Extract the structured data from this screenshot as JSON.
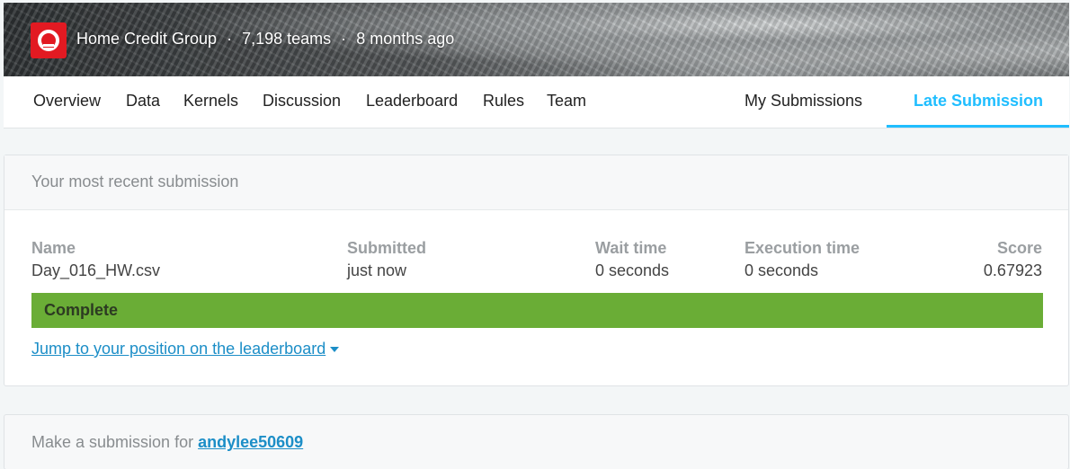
{
  "banner": {
    "host": "Home Credit Group",
    "teams": "7,198 teams",
    "age": "8 months ago",
    "separator": "·"
  },
  "nav": {
    "left_tabs": [
      "Overview",
      "Data",
      "Kernels",
      "Discussion",
      "Leaderboard",
      "Rules",
      "Team"
    ],
    "my_submissions": "My Submissions",
    "late_submission": "Late Submission"
  },
  "recent": {
    "heading": "Your most recent submission",
    "columns": {
      "name": "Name",
      "submitted": "Submitted",
      "wait": "Wait time",
      "execution": "Execution time",
      "score": "Score"
    },
    "values": {
      "name": "Day_016_HW.csv",
      "submitted": "just now",
      "wait": "0 seconds",
      "execution": "0 seconds",
      "score": "0.67923"
    },
    "status": "Complete",
    "jump_link": "Jump to your position on the leaderboard"
  },
  "make_submission": {
    "prefix": "Make a submission for",
    "user": "andylee50609"
  },
  "colors": {
    "accent": "#20beff",
    "status_complete": "#6aad36",
    "link": "#1c8ec7",
    "logo": "#e21a22"
  }
}
